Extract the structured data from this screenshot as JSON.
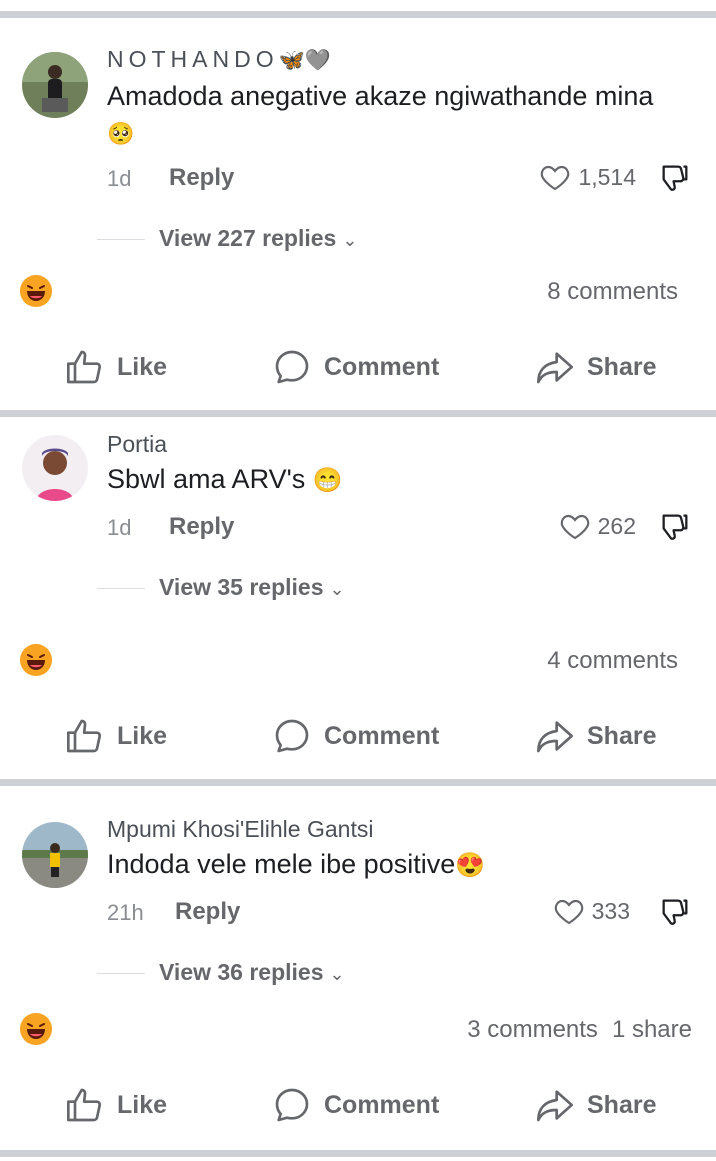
{
  "posts": [
    {
      "author": "NOTHANDO",
      "author_emoji": "🦋🩶",
      "comment": "Amadoda anegative akaze ngiwathande mina",
      "comment_emoji": "🥺",
      "time": "1d",
      "reply_label": "Reply",
      "likes": "1,514",
      "view_replies": "View 227 replies",
      "reaction_icon": "laughing-emoji-icon",
      "comments_count": "8 comments",
      "shares_count": ""
    },
    {
      "author": "Portia",
      "author_emoji": "",
      "comment": "Sbwl ama ARV's",
      "comment_emoji": "😁",
      "time": "1d",
      "reply_label": "Reply",
      "likes": "262",
      "view_replies": "View 35 replies",
      "reaction_icon": "laughing-emoji-icon",
      "comments_count": "4 comments",
      "shares_count": ""
    },
    {
      "author": "Mpumi Khosi'Elihle Gantsi",
      "author_emoji": "",
      "comment": "Indoda vele mele ibe positive",
      "comment_emoji": "😍",
      "time": "21h",
      "reply_label": "Reply",
      "likes": "333",
      "view_replies": "View 36 replies",
      "reaction_icon": "laughing-emoji-icon",
      "comments_count": "3 comments",
      "shares_count": "1 share"
    }
  ],
  "actions": {
    "like": "Like",
    "comment": "Comment",
    "share": "Share"
  },
  "colors": {
    "separator": "#cdd1d6",
    "secondary_text": "#65676b",
    "primary_text": "#1c1e21"
  }
}
